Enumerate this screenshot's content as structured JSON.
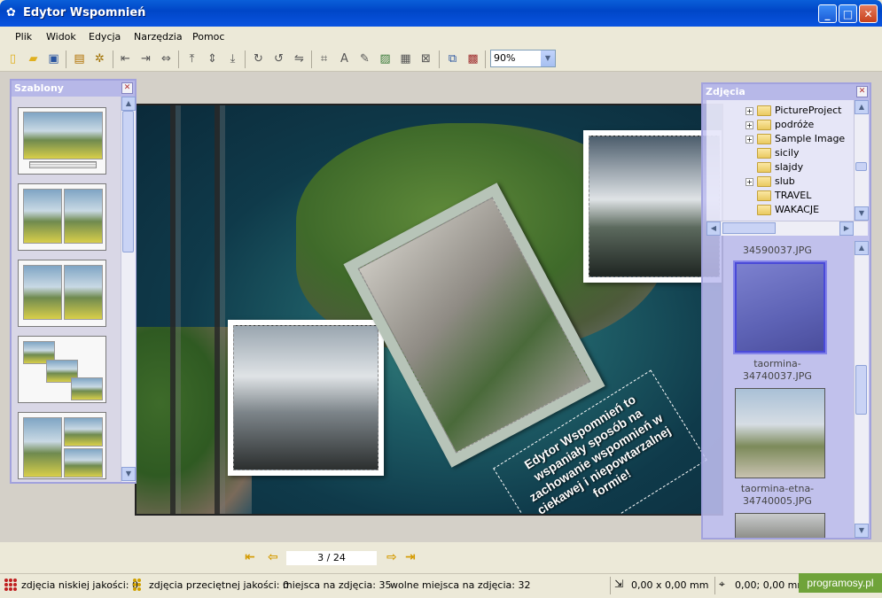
{
  "window": {
    "title": "Edytor Wspomnień"
  },
  "menu": {
    "items": [
      "Plik",
      "Widok",
      "Edycja",
      "Narzędzia",
      "Pomoc"
    ]
  },
  "toolbar": {
    "zoom": "90%"
  },
  "templates_panel": {
    "title": "Szablony"
  },
  "photos_panel": {
    "title": "Zdjęcia",
    "folders": [
      {
        "label": "PictureProject",
        "expandable": true
      },
      {
        "label": "podróże",
        "expandable": true
      },
      {
        "label": "Sample Image",
        "expandable": true
      },
      {
        "label": "sicily",
        "expandable": false
      },
      {
        "label": "slajdy",
        "expandable": false
      },
      {
        "label": "slub",
        "expandable": true
      },
      {
        "label": "TRAVEL",
        "expandable": false
      },
      {
        "label": "WAKACJE",
        "expandable": false
      }
    ],
    "files": [
      "34590037.JPG",
      "taormina-\n34740037.JPG",
      "taormina-etna-\n34740005.JPG"
    ]
  },
  "page": {
    "caption": "Edytor Wspomnień to wspaniały sposób na zachowanie wspomnień w ciekawej i niepowtarzalnej formie!"
  },
  "pager": {
    "page": "3 / 24"
  },
  "status": {
    "low_quality": "zdjęcia niskiej jakości: 0",
    "mid_quality": "zdjęcia przeciętnej jakości: 0",
    "places": "miejsca na zdjęcia: 35",
    "free_places": "wolne miejsca na zdjęcia: 32",
    "size": "0,00 x 0,00 mm",
    "position": "0,00; 0,00 mm"
  },
  "watermark": "programosy.pl",
  "colors": {
    "titlebar": "#0a54e0",
    "panel_header": "#b7b8e8",
    "selected_thumb": "#6f6fe0"
  }
}
